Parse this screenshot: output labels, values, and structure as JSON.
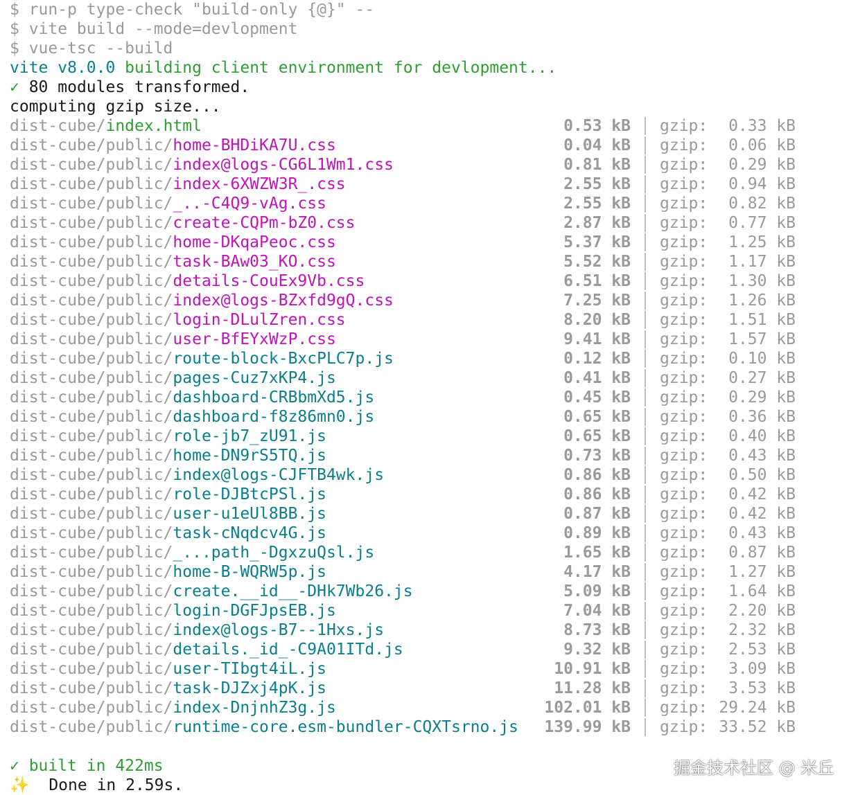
{
  "commands": [
    "$ run-p type-check \"build-only {@}\" --",
    "$ vite build --mode=devlopment",
    "$ vue-tsc --build"
  ],
  "vite_line": {
    "prefix": "vite v8.0.0",
    "text": " building client environment for devlopment..."
  },
  "transformed_line": {
    "check": "✓",
    "text": " 80 modules transformed."
  },
  "gzip_compute": "computing gzip size...",
  "files": [
    {
      "dir": "dist-cube/",
      "name": "index.html",
      "kind": "html",
      "size": "0.53 kB",
      "gzip_label": "gzip:",
      "gzip": "0.33 kB"
    },
    {
      "dir": "dist-cube/public/",
      "name": "home-BHDiKA7U.css",
      "kind": "css",
      "size": "0.04 kB",
      "gzip_label": "gzip:",
      "gzip": "0.06 kB"
    },
    {
      "dir": "dist-cube/public/",
      "name": "index@logs-CG6L1Wm1.css",
      "kind": "css",
      "size": "0.81 kB",
      "gzip_label": "gzip:",
      "gzip": "0.29 kB"
    },
    {
      "dir": "dist-cube/public/",
      "name": "index-6XWZW3R_.css",
      "kind": "css",
      "size": "2.55 kB",
      "gzip_label": "gzip:",
      "gzip": "0.94 kB"
    },
    {
      "dir": "dist-cube/public/",
      "name": "_..-C4Q9-vAg.css",
      "kind": "css",
      "size": "2.55 kB",
      "gzip_label": "gzip:",
      "gzip": "0.82 kB"
    },
    {
      "dir": "dist-cube/public/",
      "name": "create-CQPm-bZ0.css",
      "kind": "css",
      "size": "2.87 kB",
      "gzip_label": "gzip:",
      "gzip": "0.77 kB"
    },
    {
      "dir": "dist-cube/public/",
      "name": "home-DKqaPeoc.css",
      "kind": "css",
      "size": "5.37 kB",
      "gzip_label": "gzip:",
      "gzip": "1.25 kB"
    },
    {
      "dir": "dist-cube/public/",
      "name": "task-BAw03_KO.css",
      "kind": "css",
      "size": "5.52 kB",
      "gzip_label": "gzip:",
      "gzip": "1.17 kB"
    },
    {
      "dir": "dist-cube/public/",
      "name": "details-CouEx9Vb.css",
      "kind": "css",
      "size": "6.51 kB",
      "gzip_label": "gzip:",
      "gzip": "1.30 kB"
    },
    {
      "dir": "dist-cube/public/",
      "name": "index@logs-BZxfd9gQ.css",
      "kind": "css",
      "size": "7.25 kB",
      "gzip_label": "gzip:",
      "gzip": "1.26 kB"
    },
    {
      "dir": "dist-cube/public/",
      "name": "login-DLulZren.css",
      "kind": "css",
      "size": "8.20 kB",
      "gzip_label": "gzip:",
      "gzip": "1.51 kB"
    },
    {
      "dir": "dist-cube/public/",
      "name": "user-BfEYxWzP.css",
      "kind": "css",
      "size": "9.41 kB",
      "gzip_label": "gzip:",
      "gzip": "1.57 kB"
    },
    {
      "dir": "dist-cube/public/",
      "name": "route-block-BxcPLC7p.js",
      "kind": "js",
      "size": "0.12 kB",
      "gzip_label": "gzip:",
      "gzip": "0.10 kB"
    },
    {
      "dir": "dist-cube/public/",
      "name": "pages-Cuz7xKP4.js",
      "kind": "js",
      "size": "0.41 kB",
      "gzip_label": "gzip:",
      "gzip": "0.27 kB"
    },
    {
      "dir": "dist-cube/public/",
      "name": "dashboard-CRBbmXd5.js",
      "kind": "js",
      "size": "0.45 kB",
      "gzip_label": "gzip:",
      "gzip": "0.29 kB"
    },
    {
      "dir": "dist-cube/public/",
      "name": "dashboard-f8z86mn0.js",
      "kind": "js",
      "size": "0.65 kB",
      "gzip_label": "gzip:",
      "gzip": "0.36 kB"
    },
    {
      "dir": "dist-cube/public/",
      "name": "role-jb7_zU91.js",
      "kind": "js",
      "size": "0.65 kB",
      "gzip_label": "gzip:",
      "gzip": "0.40 kB"
    },
    {
      "dir": "dist-cube/public/",
      "name": "home-DN9rS5TQ.js",
      "kind": "js",
      "size": "0.73 kB",
      "gzip_label": "gzip:",
      "gzip": "0.43 kB"
    },
    {
      "dir": "dist-cube/public/",
      "name": "index@logs-CJFTB4wk.js",
      "kind": "js",
      "size": "0.86 kB",
      "gzip_label": "gzip:",
      "gzip": "0.50 kB"
    },
    {
      "dir": "dist-cube/public/",
      "name": "role-DJBtcPSl.js",
      "kind": "js",
      "size": "0.86 kB",
      "gzip_label": "gzip:",
      "gzip": "0.42 kB"
    },
    {
      "dir": "dist-cube/public/",
      "name": "user-u1eUl8BB.js",
      "kind": "js",
      "size": "0.87 kB",
      "gzip_label": "gzip:",
      "gzip": "0.42 kB"
    },
    {
      "dir": "dist-cube/public/",
      "name": "task-cNqdcv4G.js",
      "kind": "js",
      "size": "0.89 kB",
      "gzip_label": "gzip:",
      "gzip": "0.43 kB"
    },
    {
      "dir": "dist-cube/public/",
      "name": "_...path_-DgxzuQsl.js",
      "kind": "js",
      "size": "1.65 kB",
      "gzip_label": "gzip:",
      "gzip": "0.87 kB"
    },
    {
      "dir": "dist-cube/public/",
      "name": "home-B-WQRW5p.js",
      "kind": "js",
      "size": "4.17 kB",
      "gzip_label": "gzip:",
      "gzip": "1.27 kB"
    },
    {
      "dir": "dist-cube/public/",
      "name": "create.__id__-DHk7Wb26.js",
      "kind": "js",
      "size": "5.09 kB",
      "gzip_label": "gzip:",
      "gzip": "1.64 kB"
    },
    {
      "dir": "dist-cube/public/",
      "name": "login-DGFJpsEB.js",
      "kind": "js",
      "size": "7.04 kB",
      "gzip_label": "gzip:",
      "gzip": "2.20 kB"
    },
    {
      "dir": "dist-cube/public/",
      "name": "index@logs-B7--1Hxs.js",
      "kind": "js",
      "size": "8.73 kB",
      "gzip_label": "gzip:",
      "gzip": "2.32 kB"
    },
    {
      "dir": "dist-cube/public/",
      "name": "details._id_-C9A01ITd.js",
      "kind": "js",
      "size": "9.32 kB",
      "gzip_label": "gzip:",
      "gzip": "2.53 kB"
    },
    {
      "dir": "dist-cube/public/",
      "name": "user-TIbgt4iL.js",
      "kind": "js",
      "size": "10.91 kB",
      "gzip_label": "gzip:",
      "gzip": "3.09 kB"
    },
    {
      "dir": "dist-cube/public/",
      "name": "task-DJZxj4pK.js",
      "kind": "js",
      "size": "11.28 kB",
      "gzip_label": "gzip:",
      "gzip": "3.53 kB"
    },
    {
      "dir": "dist-cube/public/",
      "name": "index-DnjnhZ3g.js",
      "kind": "js",
      "size": "102.01 kB",
      "gzip_label": "gzip:",
      "gzip": "29.24 kB"
    },
    {
      "dir": "dist-cube/public/",
      "name": "runtime-core.esm-bundler-CQXTsrno.js",
      "kind": "js",
      "size": "139.99 kB",
      "gzip_label": "gzip:",
      "gzip": "33.52 kB"
    }
  ],
  "built_line": {
    "check": "✓",
    "text": " built in 422ms"
  },
  "done_line": {
    "icon": "✨",
    "text": "  Done in 2.59s."
  },
  "watermark": "掘金技术社区 @ 米丘",
  "colors": {
    "background": "#ffffff",
    "dim": "#9a9a9a",
    "css_file": "#c014b9",
    "js_file": "#0a7f8c",
    "html_file": "#2f9e33",
    "success": "#2f9e33"
  }
}
